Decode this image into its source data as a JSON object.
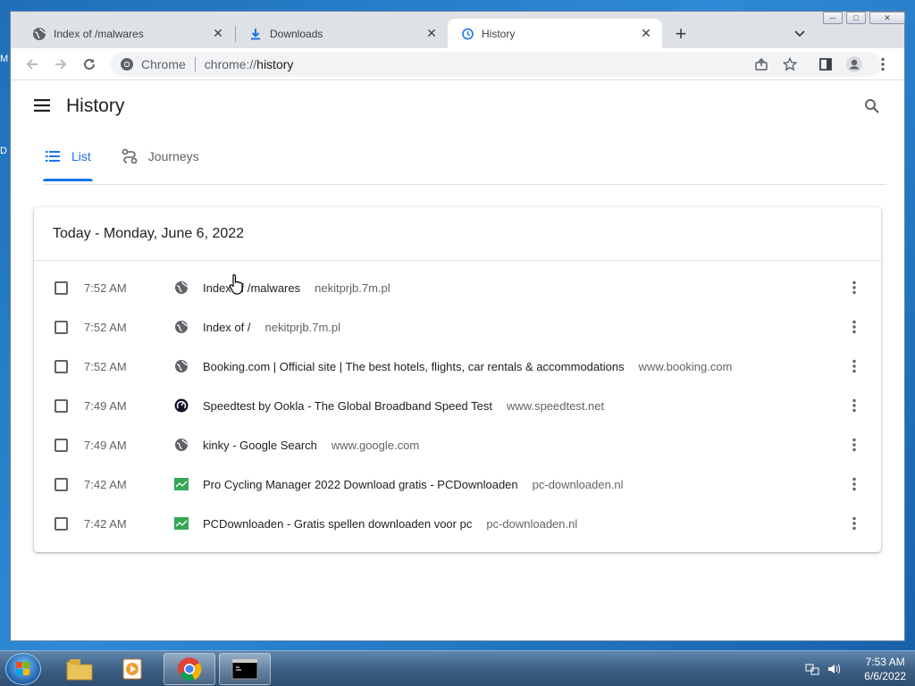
{
  "desktop": {
    "left_chars": [
      "M",
      "D"
    ]
  },
  "browser": {
    "tabs": [
      {
        "label": "Index of /malwares",
        "icon": "globe-icon"
      },
      {
        "label": "Downloads",
        "icon": "download-icon"
      },
      {
        "label": "History",
        "icon": "history-icon",
        "active": true
      }
    ],
    "window_controls": {
      "minimize": "─",
      "maximize": "□",
      "close": "✕"
    },
    "omnibox": {
      "chip": "Chrome",
      "scheme": "chrome://",
      "path": "history"
    }
  },
  "history": {
    "title": "History",
    "tabs": [
      "List",
      "Journeys"
    ],
    "date_header": "Today - Monday, June 6, 2022",
    "items": [
      {
        "time": "7:52 AM",
        "title": "Index of /malwares",
        "domain": "nekitprjb.7m.pl",
        "icon": "globe-icon"
      },
      {
        "time": "7:52 AM",
        "title": "Index of /",
        "domain": "nekitprjb.7m.pl",
        "icon": "globe-icon"
      },
      {
        "time": "7:52 AM",
        "title": "Booking.com | Official site | The best hotels, flights, car rentals & accommodations",
        "domain": "www.booking.com",
        "icon": "globe-icon"
      },
      {
        "time": "7:49 AM",
        "title": "Speedtest by Ookla - The Global Broadband Speed Test",
        "domain": "www.speedtest.net",
        "icon": "speedtest-icon"
      },
      {
        "time": "7:49 AM",
        "title": "kinky - Google Search",
        "domain": "www.google.com",
        "icon": "globe-icon"
      },
      {
        "time": "7:42 AM",
        "title": "Pro Cycling Manager 2022 Download gratis - PCDownloaden",
        "domain": "pc-downloaden.nl",
        "icon": "pcdownloaden-icon"
      },
      {
        "time": "7:42 AM",
        "title": "PCDownloaden - Gratis spellen downloaden voor pc",
        "domain": "pc-downloaden.nl",
        "icon": "pcdownloaden-icon"
      }
    ]
  },
  "taskbar": {
    "clock_time": "7:53 AM",
    "clock_date": "6/6/2022"
  },
  "colors": {
    "accent": "#1a73e8",
    "pcdl_green": "#34a853"
  }
}
